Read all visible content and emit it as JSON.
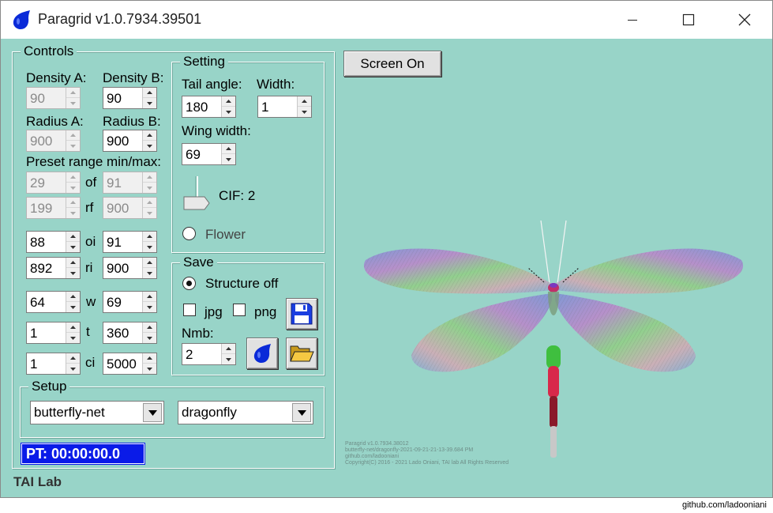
{
  "window": {
    "title": "Paragrid v1.0.7934.39501"
  },
  "controls": {
    "title": "Controls",
    "density_a_label": "Density A:",
    "density_b_label": "Density B:",
    "density_a": "90",
    "density_b": "90",
    "radius_a_label": "Radius A:",
    "radius_b_label": "Radius B:",
    "radius_a": "900",
    "radius_b": "900",
    "preset_label": "Preset range min/max:",
    "of_label": "of",
    "of_min": "29",
    "of_max": "91",
    "rf_label": "rf",
    "rf_min": "199",
    "rf_max": "900",
    "oi_label": "oi",
    "oi_min": "88",
    "oi_max": "91",
    "ri_label": "ri",
    "ri_min": "892",
    "ri_max": "900",
    "w_label": "w",
    "w_min": "64",
    "w_max": "69",
    "t_label": "t",
    "t_min": "1",
    "t_max": "360",
    "ci_label": "ci",
    "ci_min": "1",
    "ci_max": "5000"
  },
  "setting": {
    "title": "Setting",
    "tail_angle_label": "Tail angle:",
    "tail_angle": "180",
    "width_label": "Width:",
    "width": "1",
    "wing_width_label": "Wing width:",
    "wing_width": "69",
    "cif_label": "CIF: 2",
    "flower_label": "Flower"
  },
  "save": {
    "title": "Save",
    "structure_label": "Structure off",
    "jpg_label": "jpg",
    "png_label": "png",
    "nmb_label": "Nmb:",
    "nmb": "2"
  },
  "setup": {
    "title": "Setup",
    "net_value": "butterfly-net",
    "shape_value": "dragonfly"
  },
  "status": {
    "pt": "PT: 00:00:00.0"
  },
  "brand": "TAI Lab",
  "screen_button": "Screen On",
  "canvas_info": {
    "line1": "Paragrid v1.0.7934.38012",
    "line2": "butterfly-net/dragonfly-2021-09-21-21-13-39.684 PM",
    "line3": "github.com/ladooniani",
    "line4": "Copyright(C) 2016 - 2021 Lado Oniani, TAI lab All Rights Reserved"
  },
  "footer": "github.com/ladooniani",
  "colors": {
    "background": "#98d4c8",
    "pt_background": "#0a1be8",
    "accent": "#0a1be8"
  },
  "icons": [
    "drop-icon",
    "minimize-icon",
    "maximize-icon",
    "close-icon",
    "floppy-disk-icon",
    "folder-open-icon",
    "chevron-down-icon"
  ]
}
